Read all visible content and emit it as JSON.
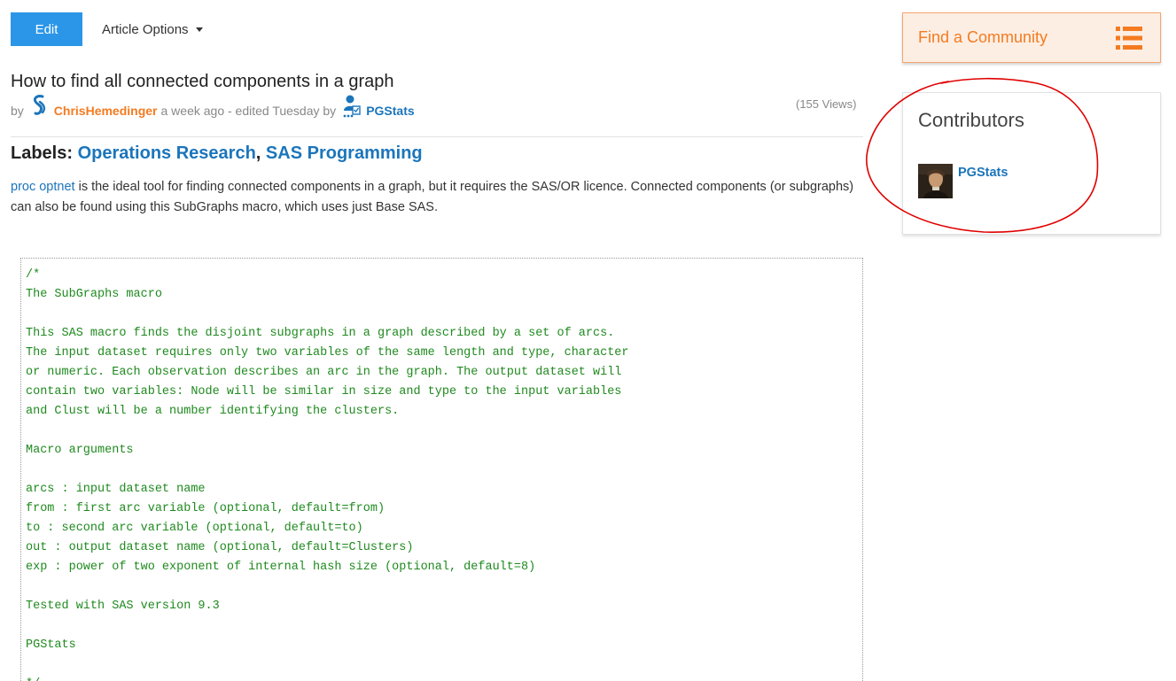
{
  "toolbar": {
    "edit_label": "Edit",
    "article_options_label": "Article Options"
  },
  "article": {
    "title": "How to find all connected components in a graph",
    "byline": {
      "by": "by",
      "author": "ChrisHemedinger",
      "meta": "a week ago - edited Tuesday by",
      "editor": "PGStats"
    },
    "views": "(155 Views)",
    "labels_prefix": "Labels:",
    "labels": [
      "Operations Research",
      "SAS Programming"
    ],
    "labels_separator": ", ",
    "intro": {
      "link": "proc optnet",
      "text": " is the ideal tool for finding connected components in a graph, but it requires the SAS/OR licence. Connected components (or subgraphs) can also be found using this SubGraphs macro, which uses just Base SAS."
    },
    "code_lines": [
      "/*",
      "The SubGraphs macro",
      "",
      "This SAS macro finds the disjoint subgraphs in a graph described by a set of arcs.",
      "The input dataset requires only two variables of the same length and type, character",
      "or numeric. Each observation describes an arc in the graph. The output dataset will",
      "contain two variables: Node will be similar in size and type to the input variables",
      "and Clust will be a number identifying the clusters.",
      "",
      "Macro arguments",
      "",
      "arcs : input dataset name",
      "from : first arc variable (optional, default=from)",
      "to : second arc variable (optional, default=to)",
      "out : output dataset name (optional, default=Clusters)",
      "exp : power of two exponent of internal hash size (optional, default=8)",
      "",
      "Tested with SAS version 9.3",
      "",
      "PGStats",
      "",
      "*/"
    ]
  },
  "sidebar": {
    "find_community_label": "Find a Community",
    "contributors_title": "Contributors",
    "contributors": [
      {
        "name": "PGStats"
      }
    ]
  },
  "colors": {
    "edit_button": "#2b96e8",
    "link": "#1b75bb",
    "author_orange": "#f47b20",
    "code_green": "#1f8a1f",
    "annotation_red": "#e00000"
  },
  "icons": {
    "author_logo": "sas-logo-icon",
    "editor_badge": "person-badge-icon",
    "find_community": "list-icon",
    "dropdown": "caret-down-icon"
  }
}
